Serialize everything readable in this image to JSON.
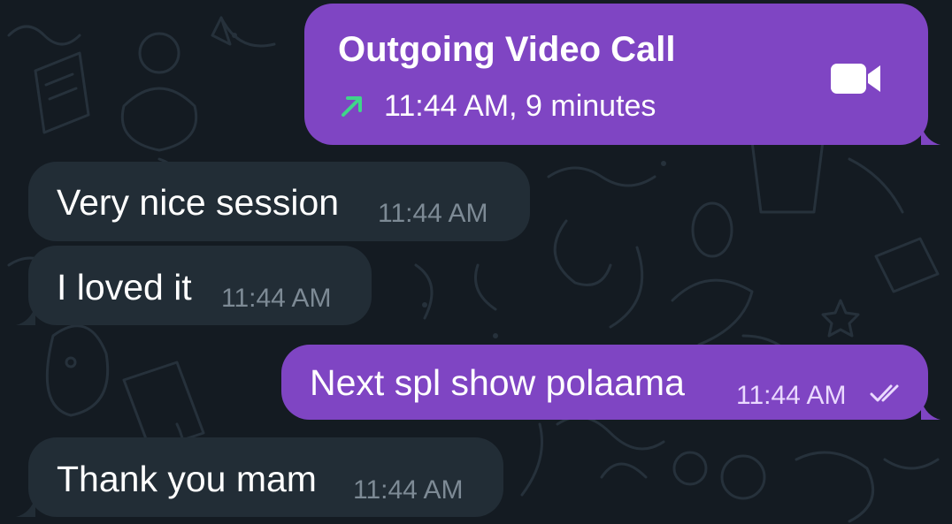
{
  "call": {
    "title": "Outgoing Video Call",
    "meta": "11:44 AM, 9 minutes",
    "direction_icon": "arrow-up-right-icon",
    "type_icon": "video-camera-icon",
    "arrow_color": "#3fd58a"
  },
  "messages": [
    {
      "text": "Very nice session",
      "time": "11:44 AM",
      "direction": "incoming"
    },
    {
      "text": "I loved it",
      "time": "11:44 AM",
      "direction": "incoming"
    },
    {
      "text": "Next spl show polaama",
      "time": "11:44 AM",
      "direction": "outgoing",
      "status_icon": "double-check-icon"
    },
    {
      "text": "Thank you mam",
      "time": "11:44 AM",
      "direction": "incoming"
    }
  ],
  "colors": {
    "background": "#141b22",
    "incoming_bubble": "#222d36",
    "outgoing_bubble": "#7f45c3"
  }
}
